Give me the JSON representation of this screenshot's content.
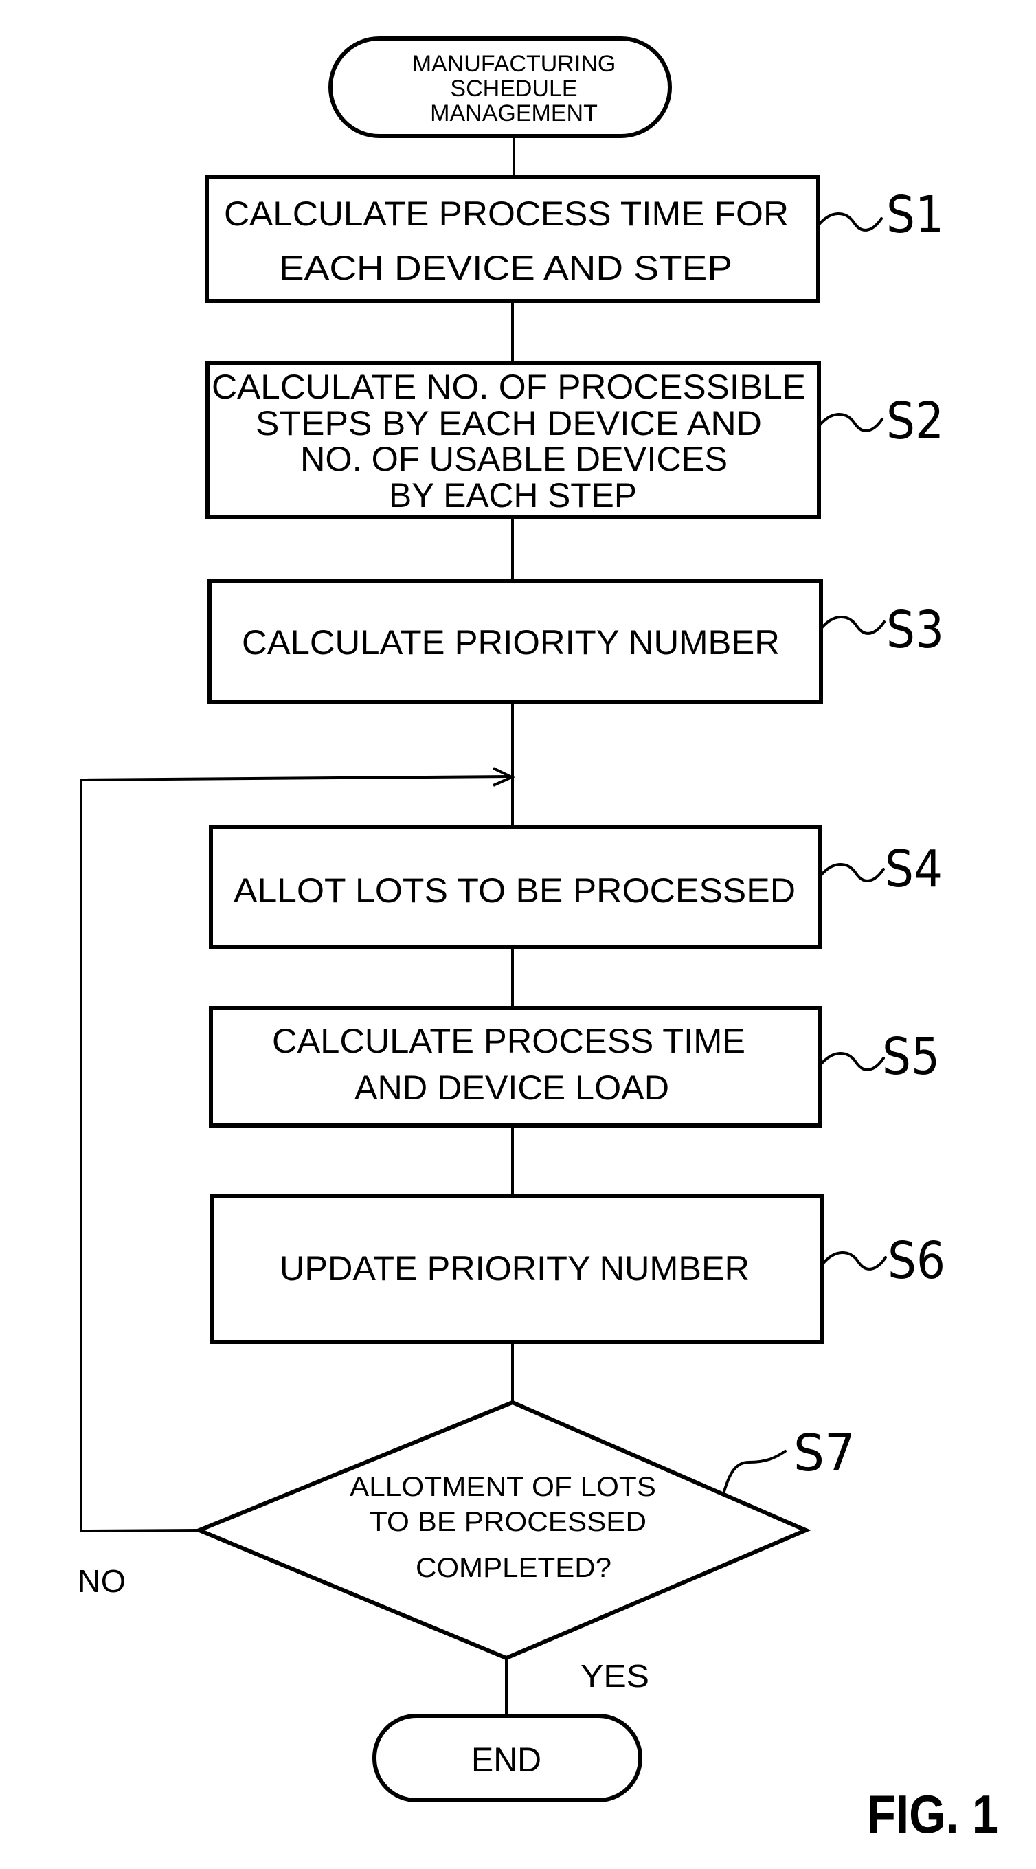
{
  "figure": {
    "title": "FIG. 1",
    "start": {
      "lines": [
        "MANUFACTURING",
        "SCHEDULE",
        "MANAGEMENT"
      ]
    },
    "steps": [
      {
        "id": "S1",
        "lines": [
          "CALCULATE PROCESS TIME FOR",
          "EACH DEVICE AND STEP"
        ]
      },
      {
        "id": "S2",
        "lines": [
          "CALCULATE NO. OF PROCESSIBLE",
          "STEPS BY EACH DEVICE AND",
          "NO. OF USABLE DEVICES",
          "BY EACH STEP"
        ]
      },
      {
        "id": "S3",
        "lines": [
          "CALCULATE PRIORITY NUMBER"
        ]
      },
      {
        "id": "S4",
        "lines": [
          "ALLOT LOTS TO BE PROCESSED"
        ]
      },
      {
        "id": "S5",
        "lines": [
          "CALCULATE PROCESS TIME",
          "AND DEVICE LOAD"
        ]
      },
      {
        "id": "S6",
        "lines": [
          "UPDATE PRIORITY NUMBER"
        ]
      }
    ],
    "decision": {
      "id": "S7",
      "lines": [
        "ALLOTMENT OF LOTS",
        "TO BE PROCESSED",
        "COMPLETED?"
      ],
      "no_label": "NO",
      "yes_label": "YES"
    },
    "end": {
      "lines": [
        "END"
      ]
    }
  }
}
